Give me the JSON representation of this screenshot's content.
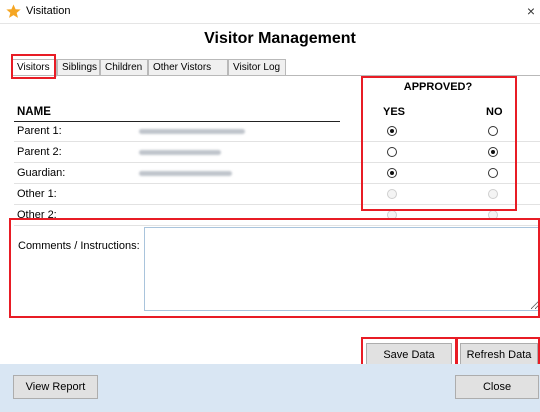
{
  "window": {
    "title": "Visitation",
    "close_glyph": "×",
    "icon": "star-icon",
    "accent": "#f5a623"
  },
  "heading": "Visitor Management",
  "tabs": [
    {
      "label": "Visitors",
      "active": true
    },
    {
      "label": "Siblings",
      "active": false
    },
    {
      "label": "Children",
      "active": false
    },
    {
      "label": "Other Vistors",
      "active": false
    },
    {
      "label": "Visitor Log",
      "active": false
    }
  ],
  "approval": {
    "title": "APPROVED?",
    "yes": "YES",
    "no": "NO"
  },
  "name_header": "NAME",
  "rows": [
    {
      "label": "Parent 1:",
      "approved": "yes",
      "enabled": true
    },
    {
      "label": "Parent 2:",
      "approved": "no",
      "enabled": true
    },
    {
      "label": "Guardian:",
      "approved": "yes",
      "enabled": true
    },
    {
      "label": "Other 1:",
      "approved": null,
      "enabled": false
    },
    {
      "label": "Other 2:",
      "approved": null,
      "enabled": false
    }
  ],
  "comments": {
    "label": "Comments / Instructions:",
    "value": ""
  },
  "buttons": {
    "save": "Save Data",
    "refresh": "Refresh Data",
    "view_report": "View Report",
    "close": "Close"
  },
  "colors": {
    "highlight": "#e81c25",
    "footer": "#d9e6f3"
  }
}
